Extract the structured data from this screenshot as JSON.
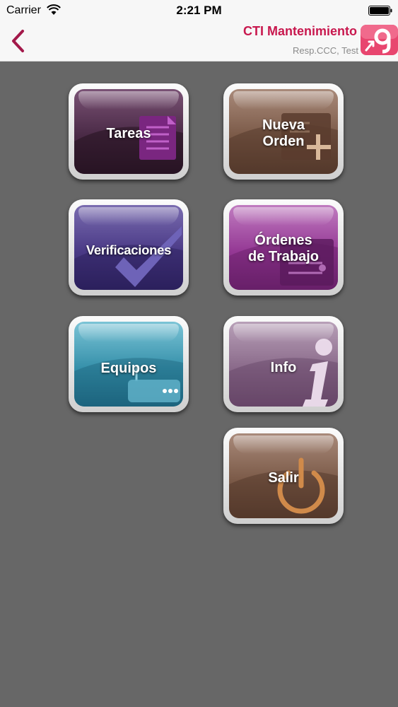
{
  "status_bar": {
    "carrier": "Carrier",
    "time": "2:21 PM"
  },
  "nav": {
    "title": "CTI Mantenimiento",
    "subtitle": "Resp.CCC, Test"
  },
  "colors": {
    "brand": "#c8184e",
    "background": "#676767"
  },
  "menu": [
    {
      "label": "Tareas",
      "icon": "document-list-icon",
      "color": "#3d2238"
    },
    {
      "label": "Nueva\nOrden",
      "icon": "add-order-icon",
      "color": "#6e4b3c"
    },
    {
      "label": "Verificaciones",
      "icon": "checkmark-icon",
      "color": "#3a2d6b"
    },
    {
      "label": "Órdenes\nde Trabajo",
      "icon": "work-order-icon",
      "color": "#8b2d86"
    },
    {
      "label": "Equipos",
      "icon": "router-icon",
      "color": "#1f7189"
    },
    {
      "label": "Info",
      "icon": "info-icon",
      "color": "#7e6178"
    },
    {
      "label": "Salir",
      "icon": "power-icon",
      "color": "#6e4b3c"
    }
  ]
}
